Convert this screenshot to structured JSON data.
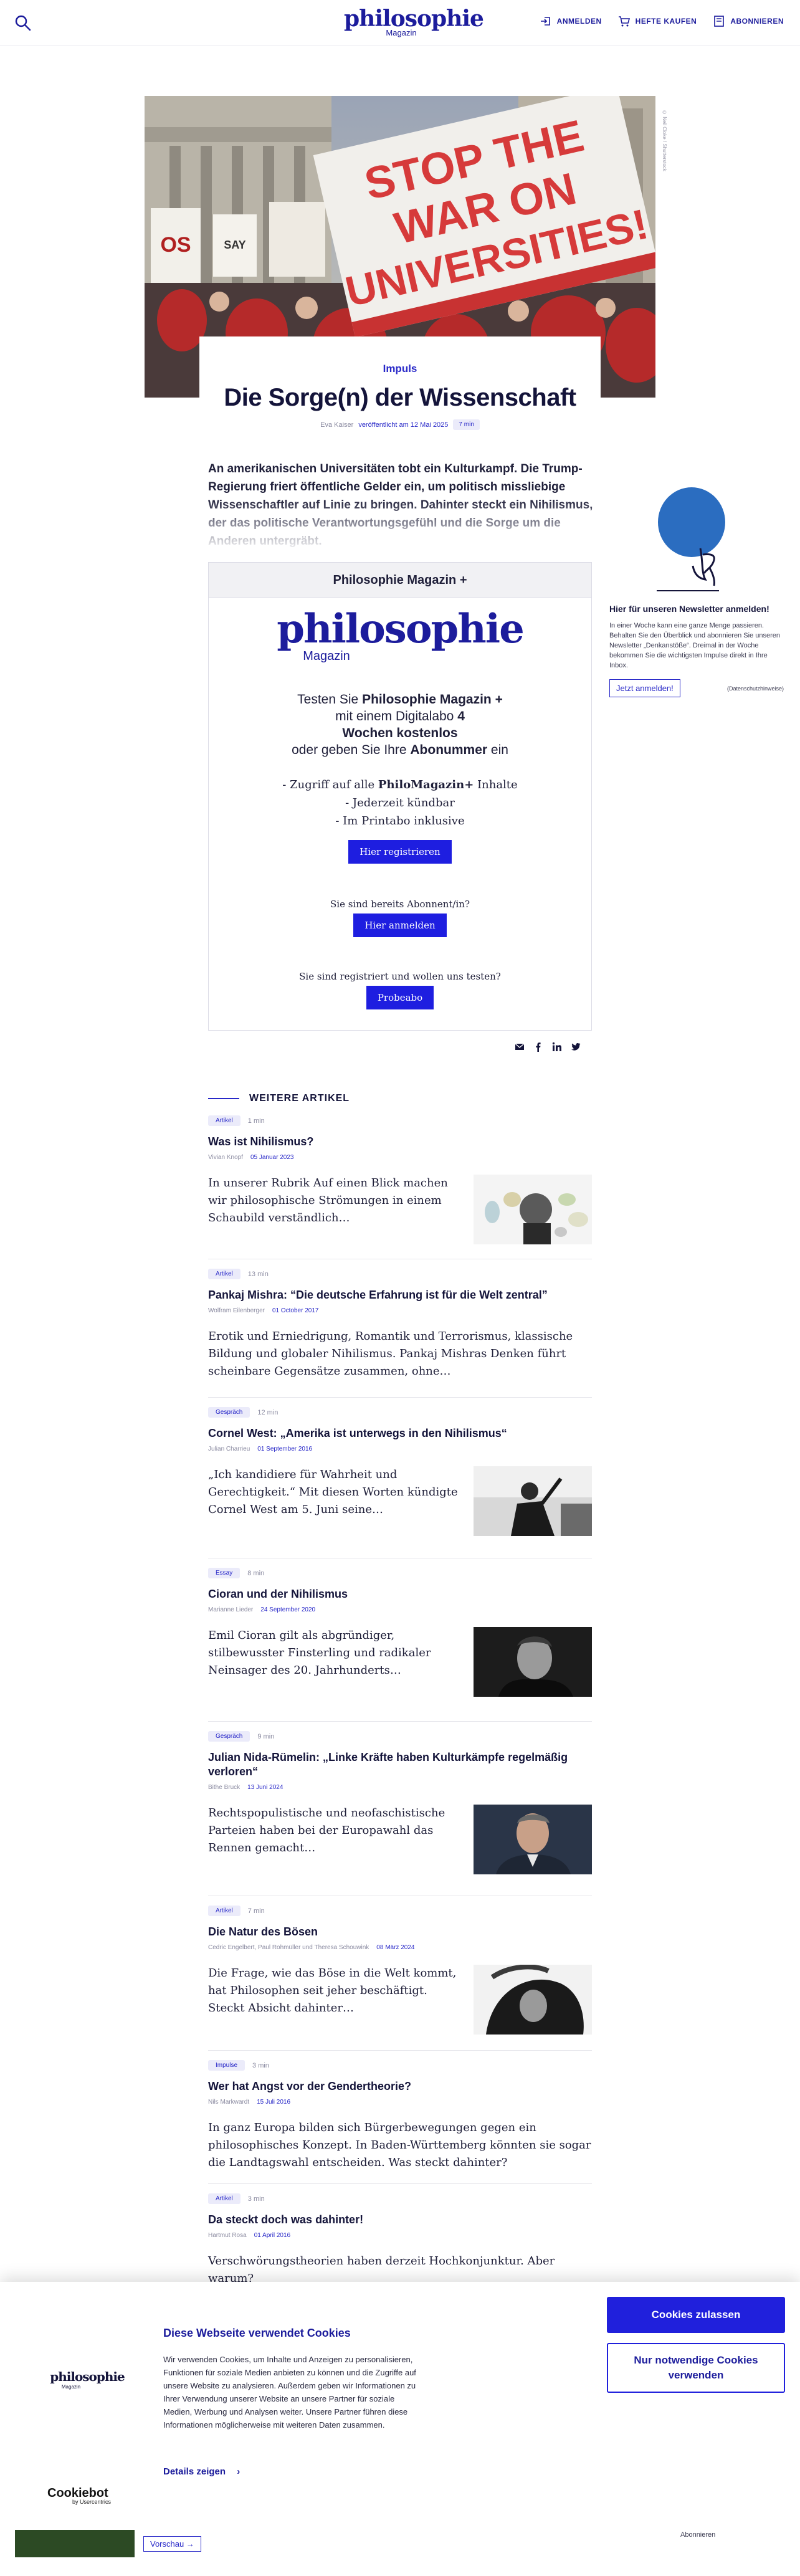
{
  "header": {
    "logo_main": "philosophie",
    "logo_sub": "Magazin",
    "login": "ANMELDEN",
    "buy": "HEFTE KAUFEN",
    "subscribe": "ABONNIEREN"
  },
  "hero": {
    "sign_text": "STOP THE WAR ON UNIVERSITIES!",
    "caption": "© Neil Cloke / Shutterstock"
  },
  "article": {
    "kicker": "Impuls",
    "title": "Die Sorge(n) der Wissenschaft",
    "author": "Eva Kaiser",
    "published": "veröffentlicht am 12 Mai 2025",
    "read_time": "7 min",
    "lead": "An amerikanischen Universitäten tobt ein Kulturkampf. Die Trump-Regierung friert öffentliche Gelder ein, um politisch missliebige Wissenschaftler auf Linie zu bringen. Dahinter steckt ein Nihilismus, der das politische Verantwortungsgefühl und die Sorge um die Anderen untergräbt."
  },
  "paywall": {
    "header": "Philosophie Magazin +",
    "logo_main": "philosophie",
    "logo_sub": "Magazin",
    "offer_1": "Testen Sie ",
    "offer_1b": "Philosophie Magazin +",
    "offer_2": "mit einem Digitalabo ",
    "offer_2b": "4",
    "offer_3b": "Wochen kostenlos",
    "offer_4": "oder geben Sie Ihre ",
    "offer_4b": "Abonummer",
    "offer_4c": " ein",
    "benefit_1": "- Zugriff auf alle ",
    "benefit_1b": "PhiloMagazin+",
    "benefit_1c": " Inhalte",
    "benefit_2": "- Jederzeit kündbar",
    "benefit_3": "- Im Printabo inklusive",
    "register_btn": "Hier registrieren",
    "already_sub": "Sie sind bereits Abonnent/in?",
    "login_btn": "Hier anmelden",
    "registered_q": "Sie sind registriert und wollen uns testen?",
    "trial_btn": "Probeabo"
  },
  "newsletter": {
    "title": "Hier für unseren Newsletter anmelden!",
    "text": "In einer Woche kann eine ganze Menge passieren. Behalten Sie den Überblick und abonnieren Sie unseren Newsletter „Denkanstöße“. Dreimal in der Woche bekommen Sie die wichtigsten Impulse direkt in Ihre Inbox.",
    "button": "Jetzt anmelden!",
    "privacy": "(Datenschutzhinweise)"
  },
  "more": {
    "heading": "WEITERE ARTIKEL",
    "articles": [
      {
        "type": "Artikel",
        "time": "1 min",
        "title": "Was ist Nihilismus?",
        "author": "Vivian Knopf",
        "date": "05 Januar 2023",
        "teaser": "In unserer Rubrik Auf einen Blick machen wir philosophische Strömungen in einem Schaubild verständlich…"
      },
      {
        "type": "Artikel",
        "time": "13 min",
        "title": "Pankaj Mishra: “Die deutsche Erfahrung ist für die Welt zentral”",
        "author": "Wolfram Eilenberger",
        "date": "01 October 2017",
        "teaser": "Erotik und Erniedrigung, Romantik und Terrorismus, klassische Bildung und globaler Nihilismus. Pankaj Mishras Denken führt scheinbare Gegensätze zusammen, ohne…"
      },
      {
        "type": "Gespräch",
        "time": "12 min",
        "title": "Cornel West: „Amerika ist unterwegs in den Nihilismus“",
        "author": "Julian Charrieu",
        "date": "01 September 2016",
        "teaser": "„Ich kandidiere für Wahrheit und Gerechtigkeit.“ Mit diesen Worten kündigte Cornel West am 5. Juni seine…"
      },
      {
        "type": "Essay",
        "time": "8 min",
        "title": "Cioran und der Nihilismus",
        "author": "Marianne Lieder",
        "date": "24 September 2020",
        "teaser": "Emil Cioran gilt als abgründiger, stilbewusster Finsterling und radikaler Neinsager des 20. Jahrhunderts…"
      },
      {
        "type": "Gespräch",
        "time": "9 min",
        "title": "Julian Nida-Rümelin: „Linke Kräfte haben Kulturkämpfe regelmäßig verloren“",
        "author": "Bithe Bruck",
        "date": "13 Juni 2024",
        "teaser": "Rechtspopulistische und neofaschistische Parteien haben bei der Europawahl das Rennen gemacht…"
      },
      {
        "type": "Artikel",
        "time": "7 min",
        "title": "Die Natur des Bösen",
        "author": "Cedric Engelbert, Paul Rohmüller und Theresa Schouwink",
        "date": "08 März 2024",
        "teaser": "Die Frage, wie das Böse in die Welt kommt, hat Philosophen seit jeher beschäftigt. Steckt Absicht dahinter…"
      },
      {
        "type": "Impulse",
        "time": "3 min",
        "title": "Wer hat Angst vor der Gendertheorie?",
        "author": "Nils Markwardt",
        "date": "15 Juli 2016",
        "teaser": "In ganz Europa bilden sich Bürgerbewegungen gegen ein philosophisches Konzept. In Baden-Württemberg könnten sie sogar die Landtagswahl entscheiden. Was steckt dahinter?"
      },
      {
        "type": "Artikel",
        "time": "3 min",
        "title": "Da steckt doch was dahinter!",
        "author": "Hartmut Rosa",
        "date": "01 April 2016",
        "teaser": "Verschwörungstheorien haben derzeit Hochkonjunktur. Aber warum?"
      }
    ]
  },
  "cookie": {
    "logo_main": "philosophie",
    "logo_sub": "Magazin",
    "title": "Diese Webseite verwendet Cookies",
    "text": "Wir verwenden Cookies, um Inhalte und Anzeigen zu personalisieren, Funktionen für soziale Medien anbieten zu können und die Zugriffe auf unsere Website zu analysieren. Außerdem geben wir Informationen zu Ihrer Verwendung unserer Website an unsere Partner für soziale Medien, Werbung und Analysen weiter. Unsere Partner führen diese Informationen möglicherweise mit weiteren Daten zusammen.",
    "details": "Details zeigen",
    "allow": "Cookies zulassen",
    "necessary": "Nur notwendige Cookies verwenden",
    "brand": "Cookiebot",
    "brand_sub": "by Usercentrics"
  },
  "bottom": {
    "preview": "Vorschau",
    "right": "Abonnieren"
  }
}
